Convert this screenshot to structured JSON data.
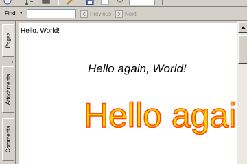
{
  "toolbar": {
    "icons": [
      "hand-tool-icon",
      "select-text-icon",
      "snapshot-icon",
      "pencil-icon",
      "save-icon",
      "page-icon",
      "zoom-field-icon"
    ]
  },
  "findbar": {
    "label": "Find:",
    "dropdown_glyph": "▾",
    "input_value": "",
    "previous_label": "Previous",
    "next_label": "Next"
  },
  "navtabs": {
    "items": [
      {
        "label": "Pages",
        "active": true
      },
      {
        "label": "Attachments",
        "active": false
      },
      {
        "label": "Comments",
        "active": false
      }
    ]
  },
  "document": {
    "line1": "Hello, World!",
    "line2": "Hello again, World!",
    "line3": "Hello again, World!",
    "colors": {
      "big_text_fill": "#ffd200",
      "big_text_stroke": "#ff4400"
    }
  }
}
